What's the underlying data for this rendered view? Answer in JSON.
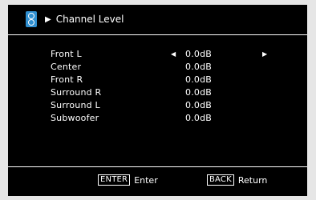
{
  "header": {
    "title": "Channel Level",
    "icon": "speaker-icon"
  },
  "channels": [
    {
      "label": "Front L",
      "value": "0.0dB",
      "selected": true
    },
    {
      "label": "Center",
      "value": "0.0dB"
    },
    {
      "label": "Front R",
      "value": "0.0dB"
    },
    {
      "label": "Surround R",
      "value": "0.0dB"
    },
    {
      "label": "Surround L",
      "value": "0.0dB"
    },
    {
      "label": "Subwoofer",
      "value": "0.0dB"
    }
  ],
  "footer": {
    "enter_key": "ENTER",
    "enter_label": "Enter",
    "back_key": "BACK",
    "back_label": "Return"
  }
}
